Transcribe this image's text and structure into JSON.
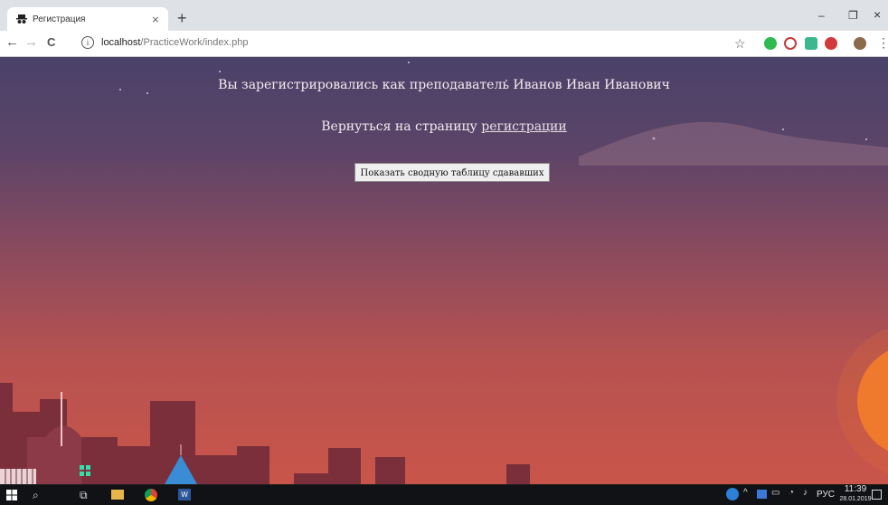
{
  "browser": {
    "tab_title": "Регистрация",
    "tab_close": "×",
    "new_tab": "+",
    "win_minimize": "–",
    "win_restore": "❐",
    "win_close": "×",
    "url_host": "localhost",
    "url_path": "/PracticeWork/index.php",
    "back_icon": "←",
    "forward_icon": "→",
    "reload_icon": "C",
    "star_icon": "☆",
    "menu_icon": "⋮",
    "info_icon": "i"
  },
  "page": {
    "message": "Вы зарегистрировались как преподаватель Иванов Иван Иванович",
    "back_text": "Вернуться на страницу ",
    "back_link": "регистрации",
    "show_button": "Показать сводную таблицу сдававших"
  },
  "taskbar": {
    "start_icon": "windows-icon",
    "search_icon": "search-icon",
    "lang": "РУС",
    "time": "11:39",
    "date": "28.01.2019"
  },
  "colors": {
    "chrome_bg": "#dee1e6",
    "sky_top": "#4a4269",
    "sky_bottom": "#c9554a",
    "sun": "#f07a2e"
  }
}
